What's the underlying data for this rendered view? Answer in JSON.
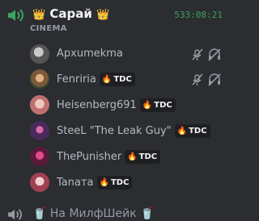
{
  "channel": {
    "crown_left": "👑",
    "name": "Сарай",
    "crown_right": "👑",
    "timer": "533:08:21",
    "category": "CINEMA"
  },
  "users": [
    {
      "name": "Архumekma",
      "tag": "",
      "muted": true
    },
    {
      "name": "Fenriria",
      "tag": "TDC",
      "muted": true
    },
    {
      "name": "Heisenberg691",
      "tag": "TDC",
      "muted": false
    },
    {
      "name": "SteeL \"The Leak Guy\"",
      "tag": "TDC",
      "muted": false
    },
    {
      "name": "ThePunisher",
      "tag": "TDC",
      "muted": false
    },
    {
      "name": "Tanата",
      "tag": "TDC",
      "muted": false
    }
  ],
  "next_channel": {
    "name": "На МилфШейк",
    "emoji": "🥤"
  },
  "colors": {
    "background": "#2b2d31",
    "accent_green": "#3ba55d",
    "tag_flame": "#ed4245"
  },
  "icons": [
    "voice-channel-icon",
    "mic-muted-icon",
    "headphones-muted-icon",
    "flame-icon"
  ]
}
